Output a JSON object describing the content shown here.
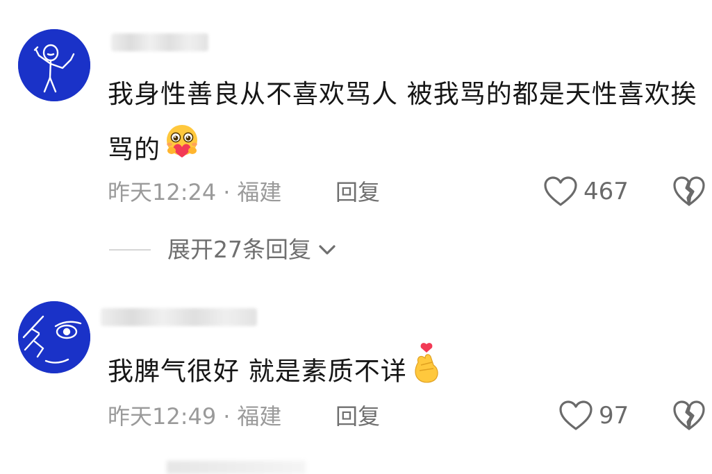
{
  "comments": [
    {
      "text": "我身性善良从不喜欢骂人 被我骂的都是天性喜欢挨骂的",
      "emoji": "hugging-face-emoji",
      "time": "昨天12:24",
      "separator": "·",
      "location": "福建",
      "reply_label": "回复",
      "likes": "467",
      "replies": {
        "expand_label": "展开27条回复"
      }
    },
    {
      "text": "我脾气很好 就是素质不详",
      "emoji": "finger-heart-emoji",
      "time": "昨天12:49",
      "separator": "·",
      "location": "福建",
      "reply_label": "回复",
      "likes": "97"
    }
  ],
  "colors": {
    "avatar_bg": "#1a32c8",
    "text": "#161616",
    "meta": "#9a9a9a",
    "action": "#6f6f6f"
  }
}
